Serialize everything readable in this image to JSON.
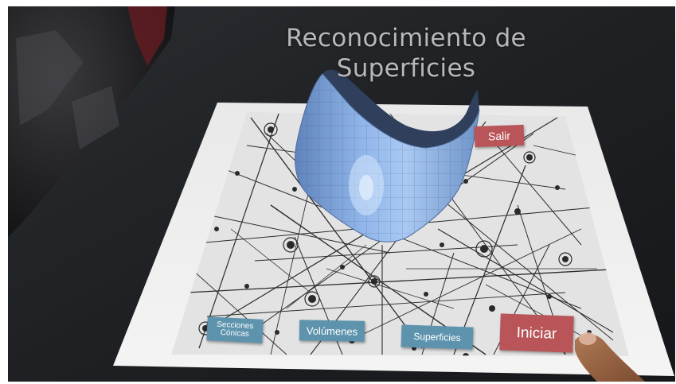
{
  "title": {
    "line1": "Reconocimiento de",
    "line2": "Superficies"
  },
  "buttons": {
    "salir": "Salir",
    "secciones_line1": "Secciones",
    "secciones_line2": "Cónicas",
    "volumenes": "Volúmenes",
    "superficies": "Superficies",
    "iniciar": "Iniciar"
  },
  "colors": {
    "menu_button_blue": "#5e93ad",
    "action_button_red": "#b95558",
    "surface_blue": "#7fa8de",
    "title_gray": "#b8b8b8"
  },
  "icons": {
    "surface_model": "saddle-surface-3d-model",
    "marker": "network-graph-marker-sheet",
    "hand": "finger"
  }
}
